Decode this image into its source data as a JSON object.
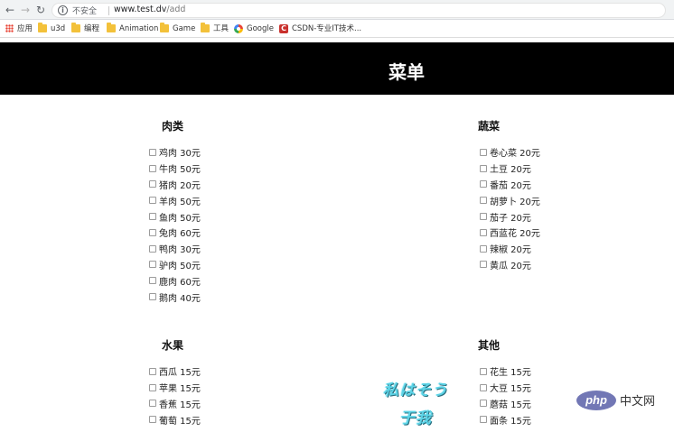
{
  "browser": {
    "security_label": "不安全",
    "url_host": "www.test.dv",
    "url_path": "/add",
    "bookmarks": [
      {
        "label": "应用",
        "icon": "apps-icon"
      },
      {
        "label": "u3d",
        "icon": "folder-icon"
      },
      {
        "label": "编程",
        "icon": "folder-icon"
      },
      {
        "label": "Animation",
        "icon": "folder-icon"
      },
      {
        "label": "Game",
        "icon": "folder-icon"
      },
      {
        "label": "工具",
        "icon": "folder-icon"
      },
      {
        "label": "Google",
        "icon": "google-icon"
      },
      {
        "label": "CSDN-专业IT技术...",
        "icon": "csdn-icon"
      }
    ],
    "nav_icons": [
      "back-icon",
      "forward-icon",
      "reload-icon"
    ]
  },
  "page": {
    "title": "菜单",
    "header_bg": "#000000"
  },
  "menu": {
    "meat": {
      "title": "肉类",
      "items": [
        "鸡肉 30元",
        "牛肉 50元",
        "猪肉 20元",
        "羊肉 50元",
        "鱼肉 50元",
        "兔肉 60元",
        "鸭肉 30元",
        "驴肉 50元",
        "鹿肉 60元",
        "鹅肉 40元"
      ]
    },
    "vegetables": {
      "title": "蔬菜",
      "items": [
        "卷心菜 20元",
        "土豆 20元",
        "番茄 20元",
        "胡萝卜 20元",
        "茄子 20元",
        "西蓝花 20元",
        "辣椒 20元",
        "黄瓜 20元"
      ]
    },
    "fruit": {
      "title": "水果",
      "items": [
        "西瓜 15元",
        "苹果 15元",
        "香蕉 15元",
        "葡萄 15元"
      ]
    },
    "other": {
      "title": "其他",
      "items": [
        "花生 15元",
        "大豆 15元",
        "蘑菇 15元",
        "面条 15元"
      ]
    }
  },
  "overlay": {
    "watermark_line1": "私はそう",
    "watermark_line2": "于我",
    "php_logo": "php",
    "php_site": "中文网"
  }
}
